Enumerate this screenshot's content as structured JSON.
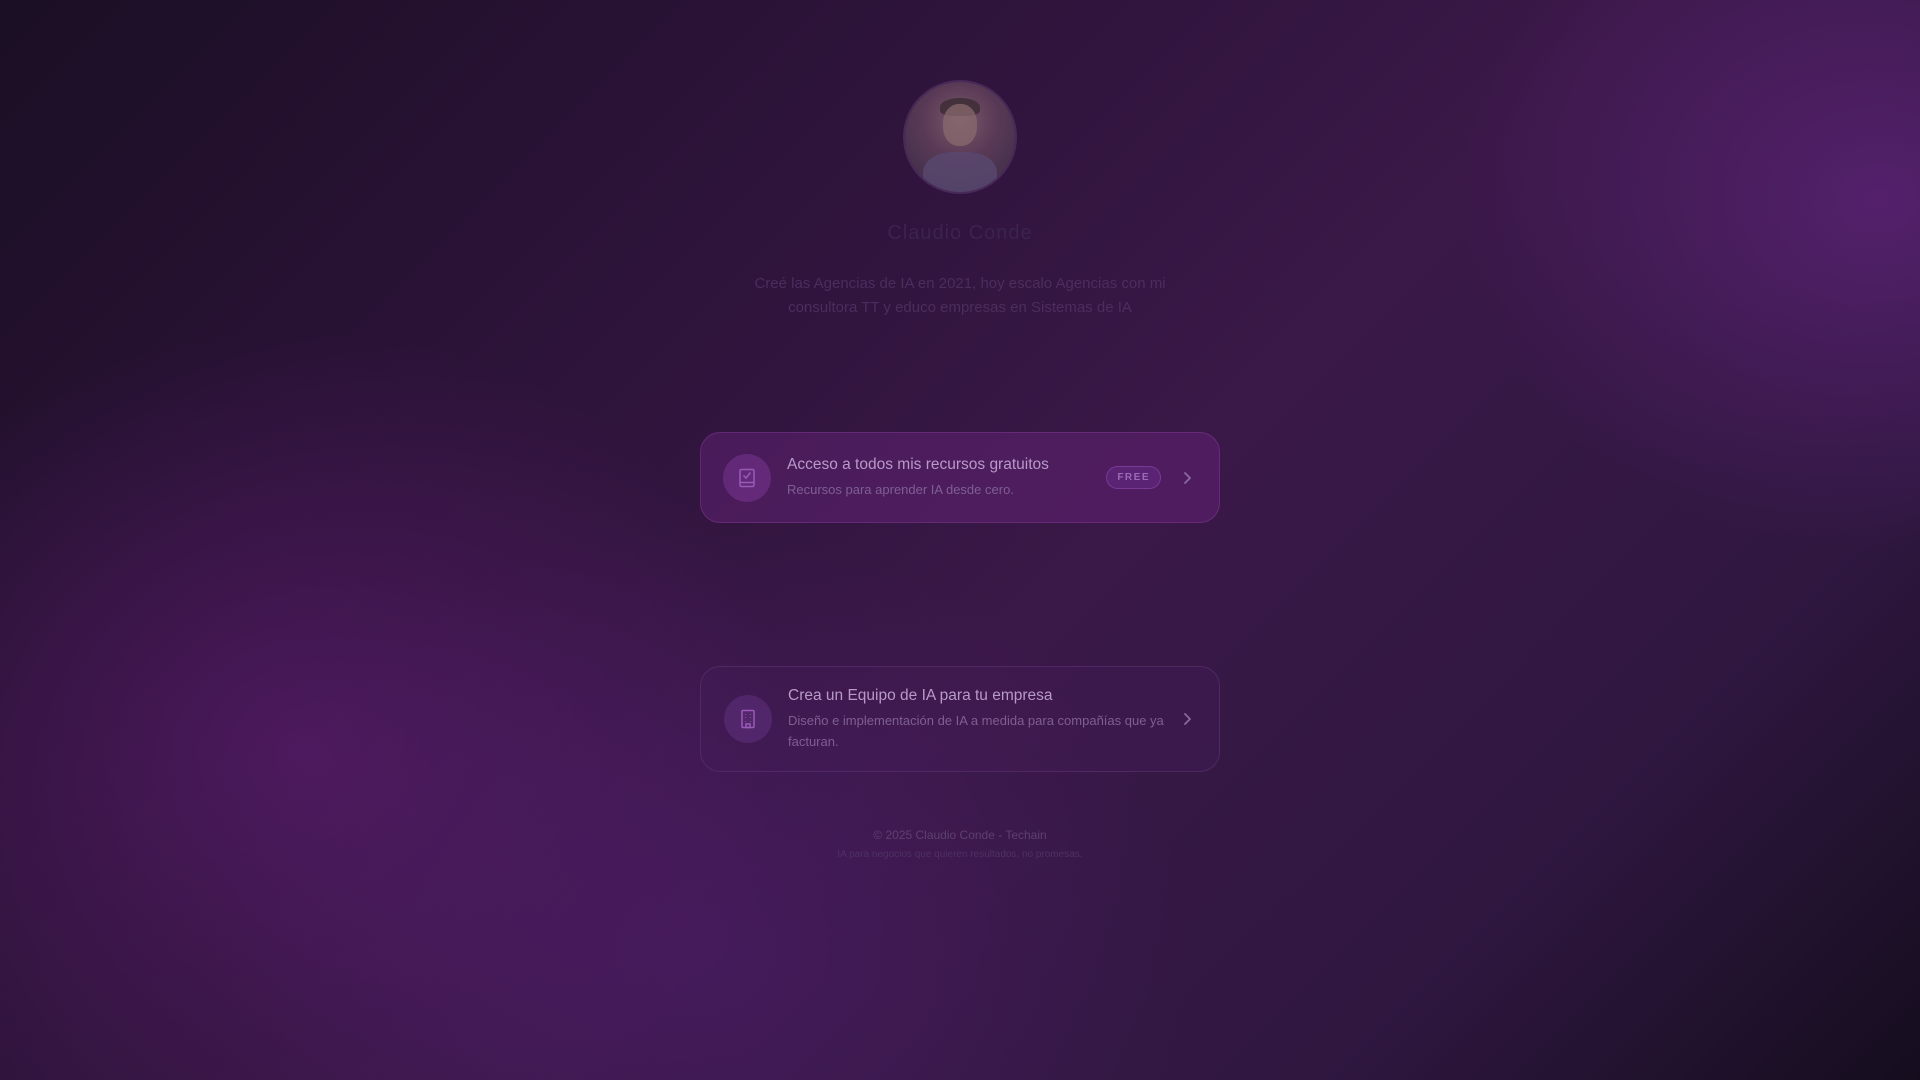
{
  "profile": {
    "name": "Claudio Conde",
    "bio": "Creé las Agencias de IA en 2021, hoy escalo Agencias con mi consultora TT y educo empresas en Sistemas de IA"
  },
  "links": [
    {
      "title": "Acceso a todos mis recursos gratuitos",
      "subtitle": "Recursos para aprender IA desde cero.",
      "badge": "FREE",
      "icon": "book-check-icon"
    },
    {
      "title": "Crea un Equipo de IA para tu empresa",
      "subtitle": "Diseño e implementación de IA a medida para compañías que ya facturan.",
      "icon": "building-icon"
    }
  ],
  "footer": {
    "copyright": "© 2025 Claudio Conde - Techain",
    "tagline": "IA para negocios que quieren resultados, no promesas."
  },
  "colors": {
    "accent": "#9a6ab8",
    "card_primary": "#5a2a6e",
    "background": "#2a1236"
  }
}
